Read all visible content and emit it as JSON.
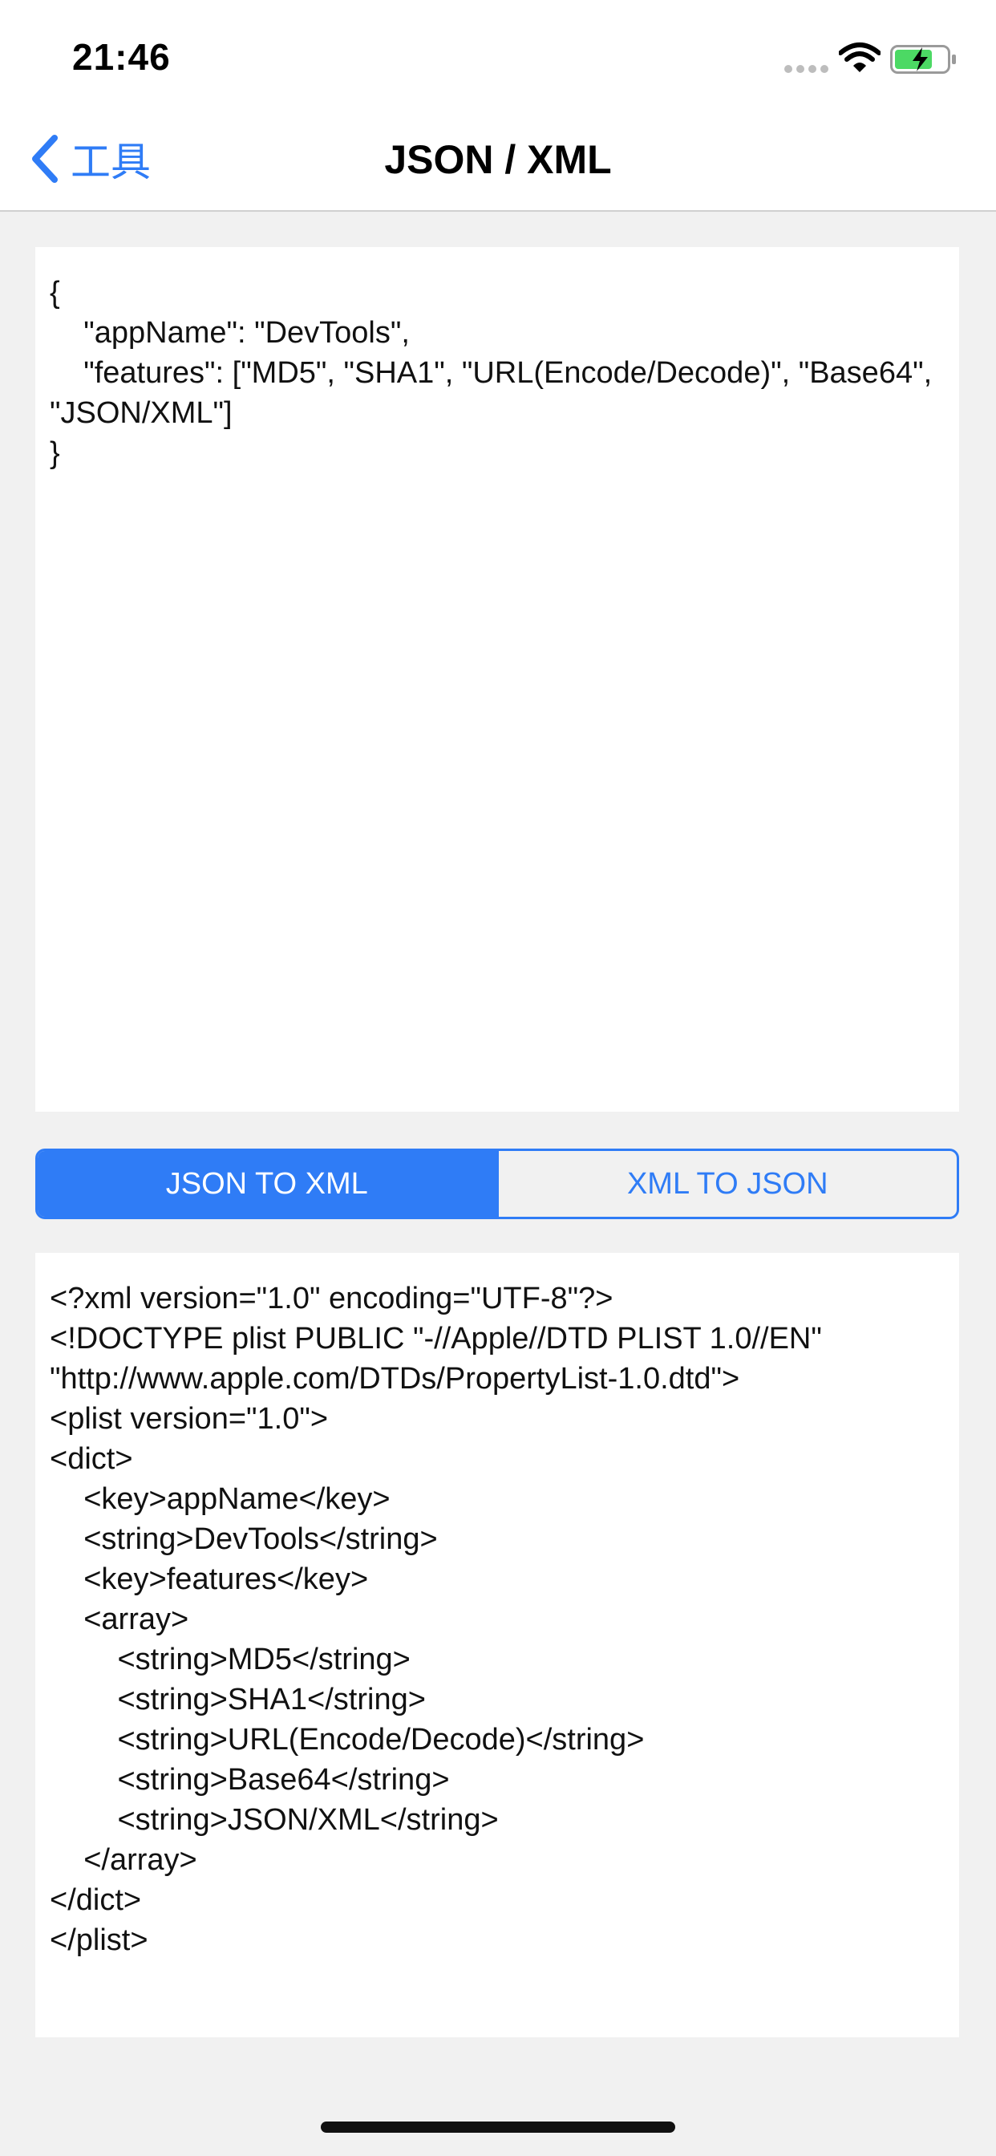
{
  "status_bar": {
    "time": "21:46",
    "icons": [
      "signal-dots-icon",
      "wifi-icon",
      "battery-charging-icon"
    ]
  },
  "nav": {
    "back_label": "工具",
    "title": "JSON / XML"
  },
  "input": {
    "text": "{\n\t\"appName\": \"DevTools\",\n\t\"features\": [\"MD5\", \"SHA1\", \"URL(Encode/Decode)\", \"Base64\", \"JSON/XML\"]\n}"
  },
  "segments": {
    "json_to_xml": "JSON TO XML",
    "xml_to_json": "XML TO JSON",
    "selected": "JSON TO XML"
  },
  "output": {
    "text": "<?xml version=\"1.0\" encoding=\"UTF-8\"?>\n<!DOCTYPE plist PUBLIC \"-//Apple//DTD PLIST 1.0//EN\" \"http://www.apple.com/DTDs/PropertyList-1.0.dtd\">\n<plist version=\"1.0\">\n<dict>\n\t<key>appName</key>\n\t<string>DevTools</string>\n\t<key>features</key>\n\t<array>\n\t\t<string>MD5</string>\n\t\t<string>SHA1</string>\n\t\t<string>URL(Encode/Decode)</string>\n\t\t<string>Base64</string>\n\t\t<string>JSON/XML</string>\n\t</array>\n</dict>\n</plist>"
  },
  "colors": {
    "accent": "#2f7cf6",
    "background": "#f1f1f1",
    "panel": "#ffffff",
    "battery_fill": "#4cd964"
  }
}
